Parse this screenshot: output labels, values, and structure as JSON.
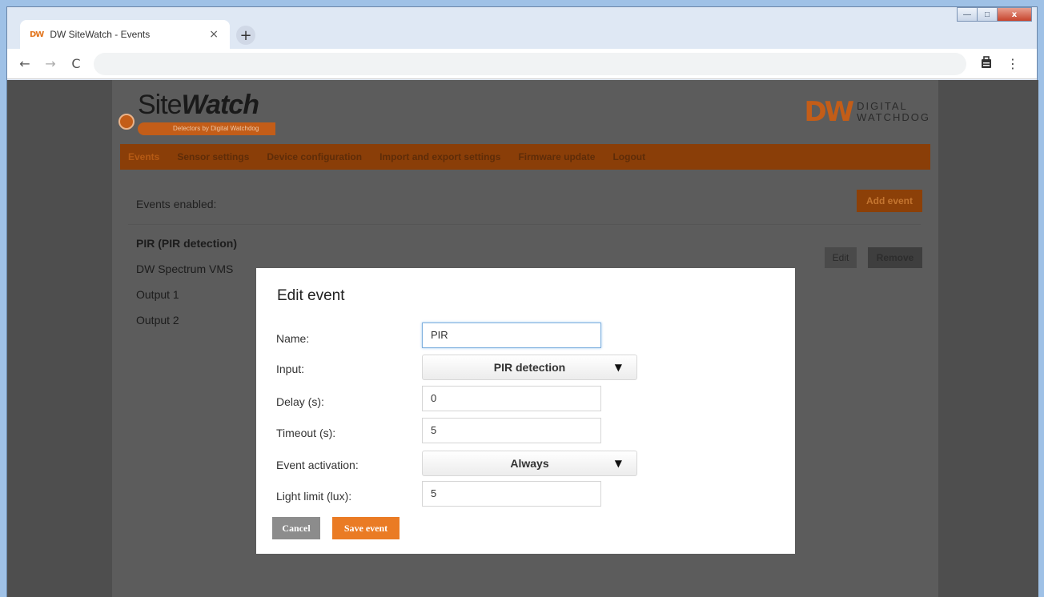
{
  "browser": {
    "favicon": "DW",
    "tab_title": "DW SiteWatch - Events",
    "tab_close": "×",
    "new_tab": "+",
    "back": "←",
    "forward": "→",
    "reload": "C",
    "extension_icon": "briefcase-icon",
    "menu_icon": "⋮"
  },
  "window_controls": {
    "minimize": "—",
    "maximize": "□",
    "close": "x"
  },
  "header": {
    "logo_prefix": "Site",
    "logo_bold": "Watch",
    "logo_tagline": "Detectors by Digital Watchdog",
    "brand_mark": "DW",
    "brand_line1": "DIGITAL",
    "brand_line2": "WATCHDOG"
  },
  "nav": {
    "items": [
      "Events",
      "Sensor settings",
      "Device configuration",
      "Import and export settings",
      "Firmware update",
      "Logout"
    ]
  },
  "events_page": {
    "enabled_label": "Events enabled:",
    "add_event": "Add event",
    "event_name": "PIR (PIR detection)",
    "event_lines": [
      "DW Spectrum VMS",
      "Output 1",
      "Output 2"
    ],
    "edit": "Edit",
    "remove": "Remove"
  },
  "modal": {
    "title": "Edit event",
    "name_label": "Name:",
    "name_value": "PIR",
    "input_label": "Input:",
    "input_value": "PIR detection",
    "delay_label": "Delay (s):",
    "delay_value": "0",
    "timeout_label": "Timeout (s):",
    "timeout_value": "5",
    "activation_label": "Event activation:",
    "activation_value": "Always",
    "light_label": "Light limit (lux):",
    "light_value": "5",
    "cancel": "Cancel",
    "save": "Save event",
    "caret": "▼"
  },
  "colors": {
    "accent": "#ea7b24",
    "navbar_dimmed": "#8a3e08",
    "overlay_page": "#5c5c5c"
  }
}
